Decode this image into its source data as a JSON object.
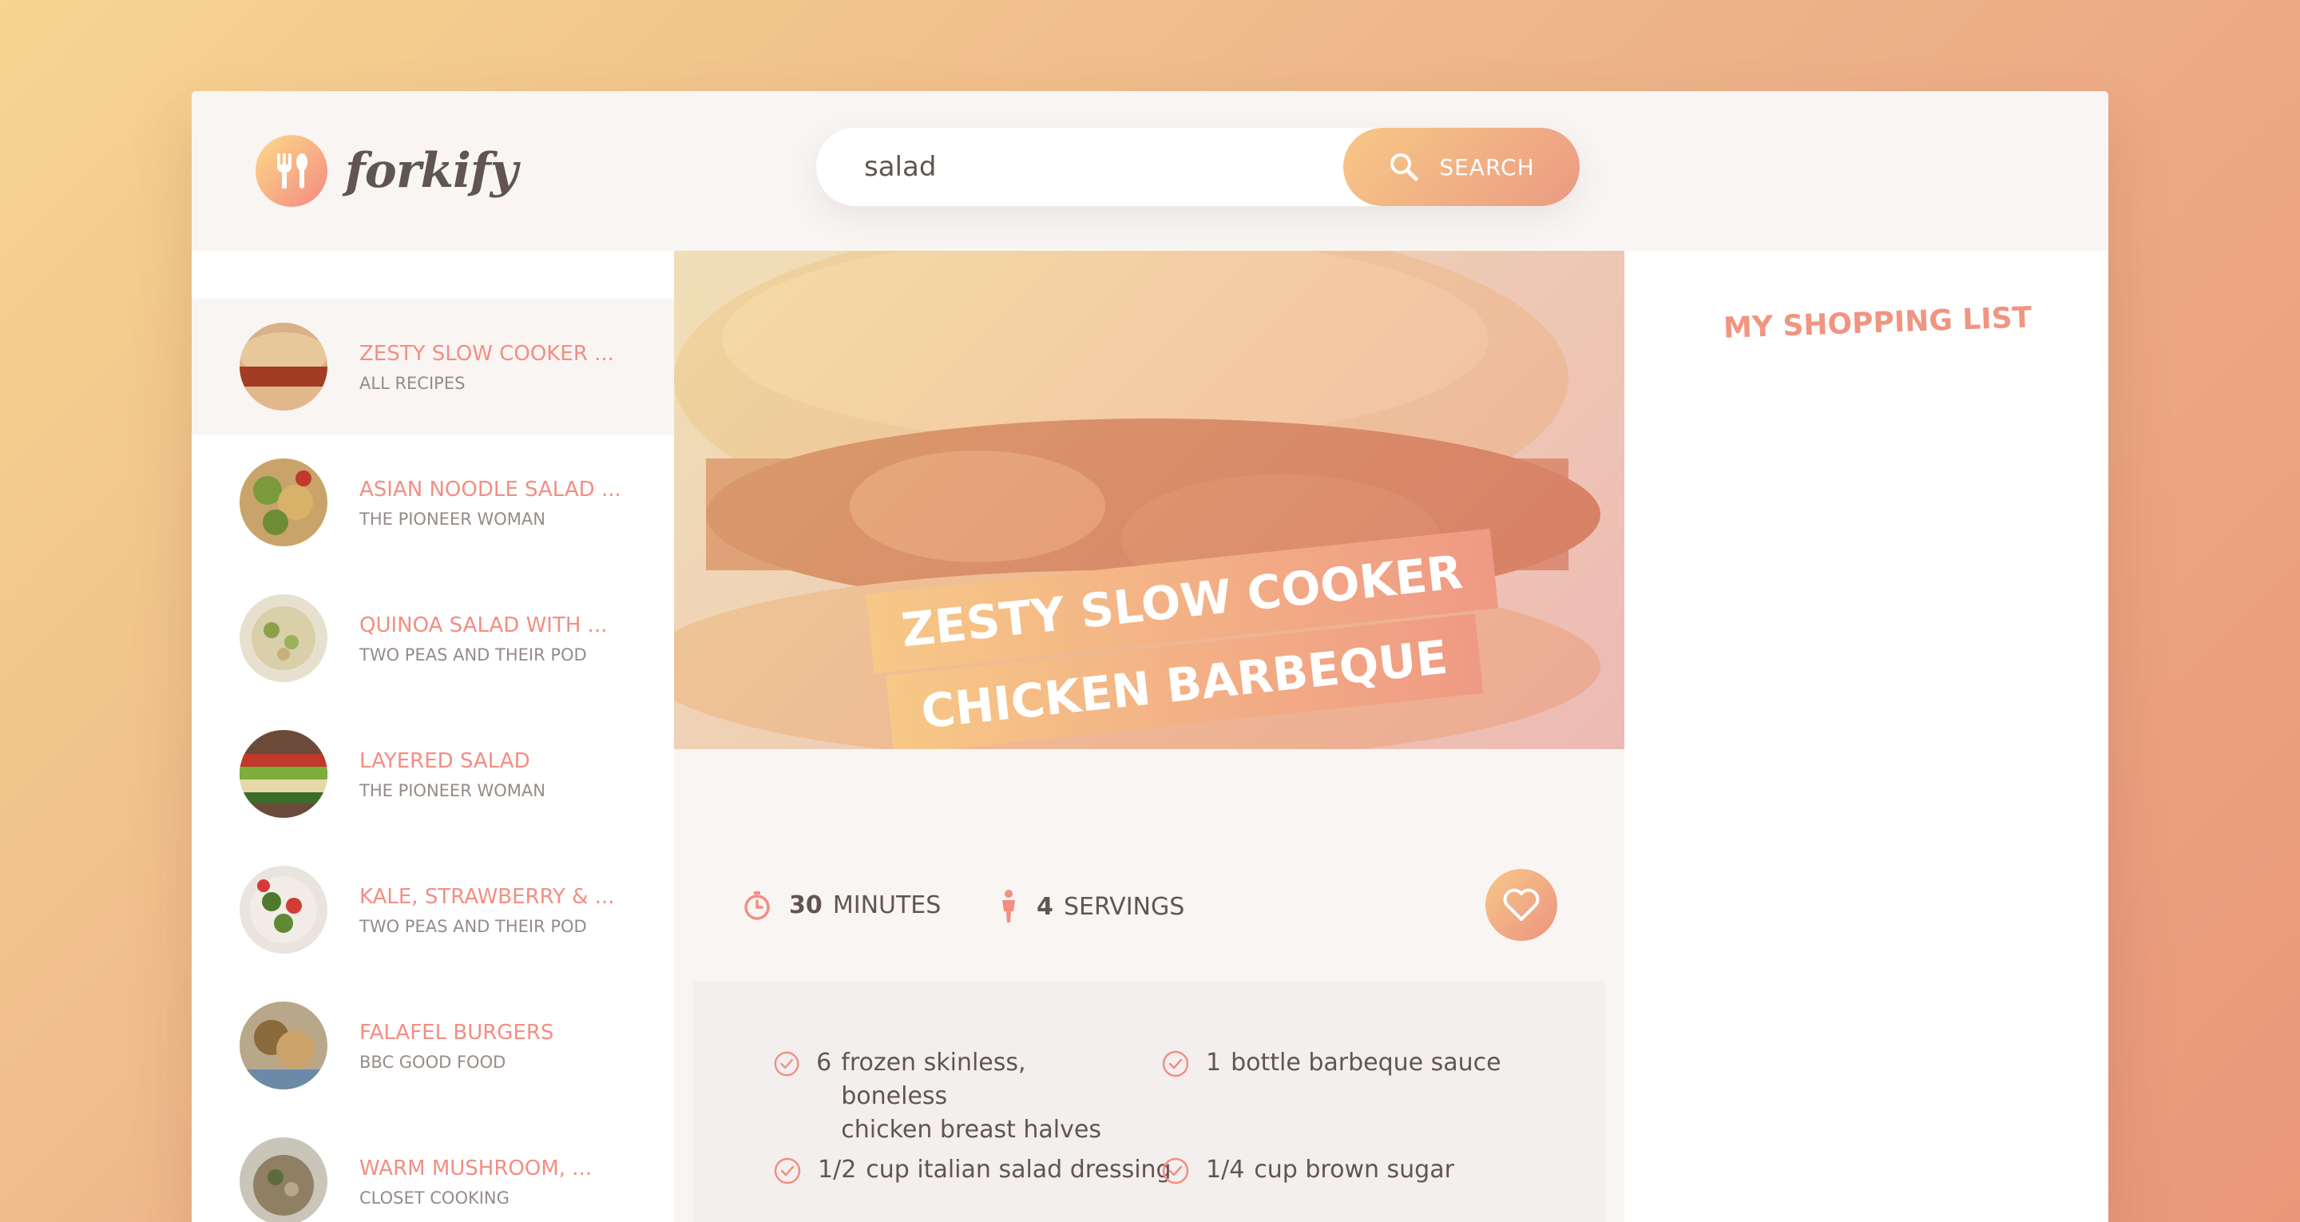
{
  "app": {
    "logo_text": "forkify"
  },
  "search": {
    "query": "salad",
    "button_label": "SEARCH"
  },
  "results": [
    {
      "title": "ZESTY SLOW COOKER ...",
      "author": "ALL RECIPES",
      "active": true
    },
    {
      "title": "ASIAN NOODLE SALAD ...",
      "author": "THE PIONEER WOMAN"
    },
    {
      "title": "QUINOA SALAD WITH ...",
      "author": "TWO PEAS AND THEIR POD"
    },
    {
      "title": "LAYERED SALAD",
      "author": "THE PIONEER WOMAN"
    },
    {
      "title": "KALE, STRAWBERRY & ...",
      "author": "TWO PEAS AND THEIR POD"
    },
    {
      "title": "FALAFEL BURGERS",
      "author": "BBC GOOD FOOD"
    },
    {
      "title": "WARM MUSHROOM, ...",
      "author": "CLOSET COOKING"
    }
  ],
  "recipe": {
    "title_line1": "ZESTY SLOW COOKER",
    "title_line2": "CHICKEN BARBEQUE",
    "time_value": "30",
    "time_unit": "MINUTES",
    "servings_value": "4",
    "servings_unit": "SERVINGS",
    "ingredients": [
      {
        "count": "6",
        "text": "frozen skinless, boneless",
        "text2": "chicken breast halves"
      },
      {
        "count": "1",
        "text": "bottle barbeque sauce"
      },
      {
        "count": "1/2",
        "text": "cup italian salad dressing"
      },
      {
        "count": "1/4",
        "text": "cup brown sugar"
      }
    ]
  },
  "shopping": {
    "title": "MY SHOPPING LIST"
  },
  "colors": {
    "accent": "#f38e82",
    "accent_light": "#fbdb89",
    "text": "#615551",
    "muted": "#968b87"
  }
}
